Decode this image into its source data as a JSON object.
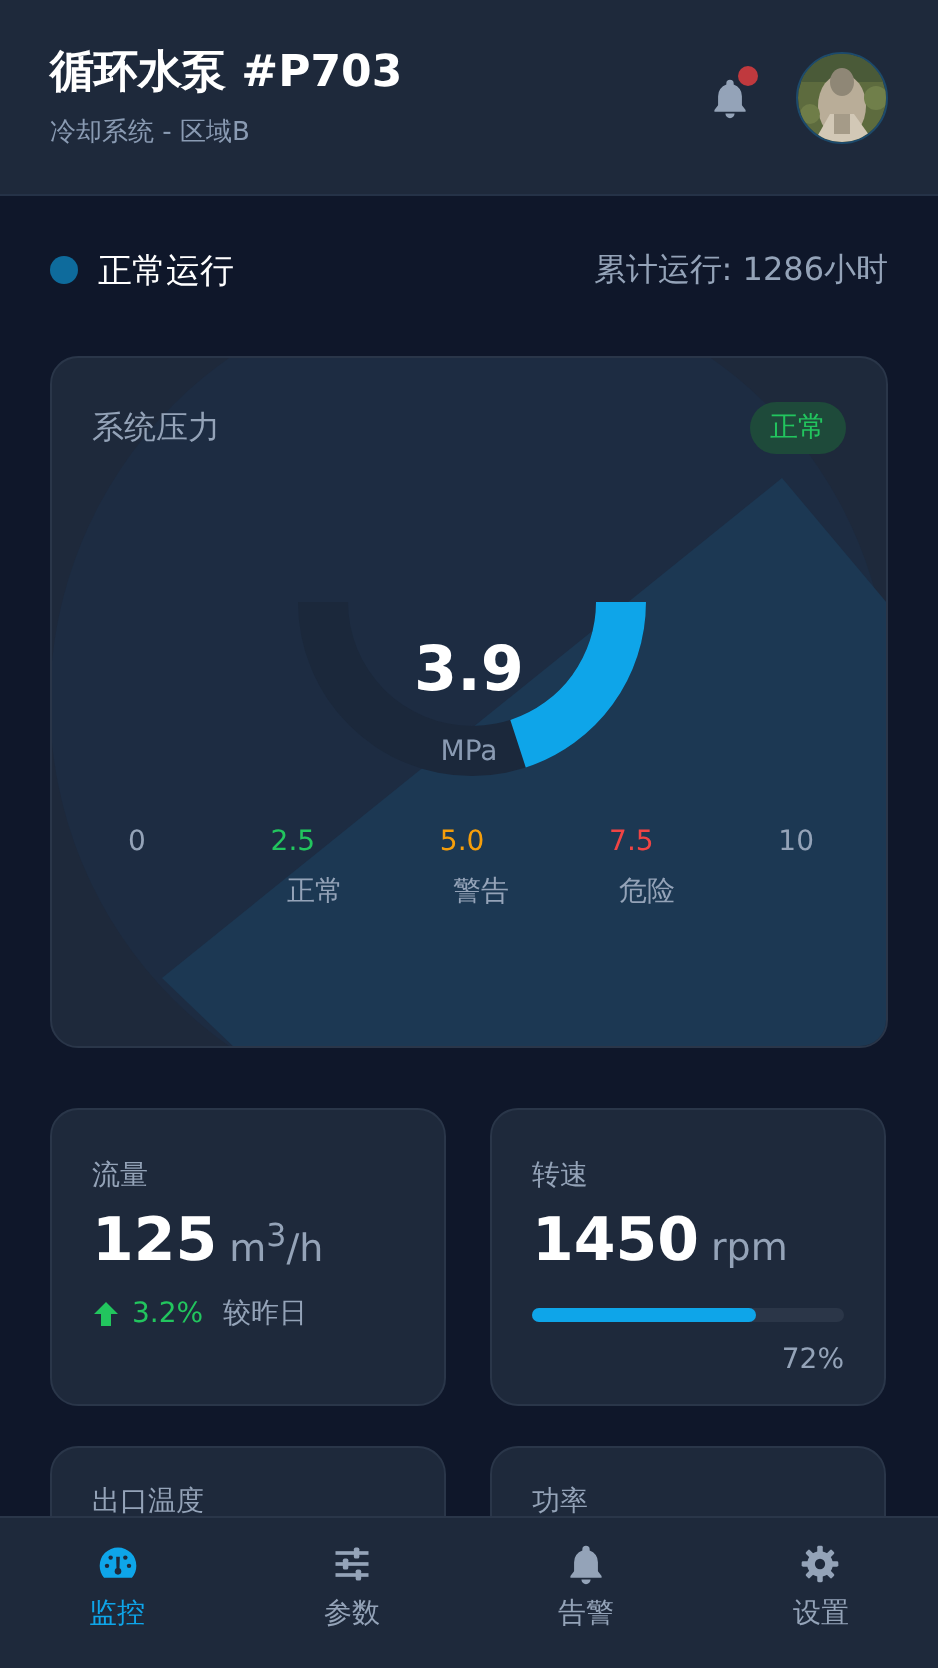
{
  "header": {
    "title": "循环水泵 #P703",
    "subtitle": "冷却系统 - 区域B",
    "notification_dot": true
  },
  "status": {
    "label": "正常运行",
    "color": "#0e6b9c",
    "uptime": "累计运行: 1286小时"
  },
  "pressure": {
    "title": "系统压力",
    "badge": "正常",
    "value": "3.9",
    "unit": "MPa",
    "scale": [
      {
        "label": "0",
        "color": "#94a3b8"
      },
      {
        "label": "2.5",
        "color": "#22c55e"
      },
      {
        "label": "5.0",
        "color": "#f59e0b"
      },
      {
        "label": "7.5",
        "color": "#ef4444"
      },
      {
        "label": "10",
        "color": "#94a3b8"
      }
    ],
    "zones": [
      "正常",
      "警告",
      "危险"
    ]
  },
  "metrics": [
    {
      "kind": "trend",
      "title": "流量",
      "value": "125",
      "unit": "m$^{3}$/h",
      "change": "3.2%",
      "change_note": "较昨日"
    },
    {
      "kind": "bar",
      "title": "转速",
      "value": "1450",
      "unit": "rpm",
      "level": 0.72,
      "percent": "72%"
    },
    {
      "kind": "title",
      "title": "出口温度"
    },
    {
      "kind": "title",
      "title": "功率"
    }
  ],
  "nav": [
    {
      "label": "监控",
      "kind": "gauge",
      "selected": true
    },
    {
      "label": "参数",
      "kind": "sliders",
      "selected": false
    },
    {
      "label": "告警",
      "kind": "bell",
      "selected": false
    },
    {
      "label": "设置",
      "kind": "gear",
      "selected": false
    }
  ]
}
